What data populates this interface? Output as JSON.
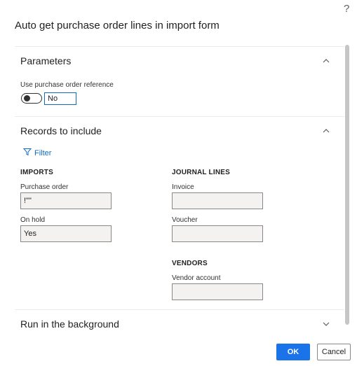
{
  "dialog": {
    "title": "Auto get purchase order lines in import form",
    "help_icon": "?"
  },
  "parameters": {
    "header": "Parameters",
    "use_po_reference_label": "Use purchase order reference",
    "use_po_reference_value": "No",
    "toggle_on": false
  },
  "records": {
    "header": "Records to include",
    "filter_label": "Filter",
    "imports": {
      "group_label": "IMPORTS",
      "purchase_order_label": "Purchase order",
      "purchase_order_value": "!\"\"",
      "on_hold_label": "On hold",
      "on_hold_value": "Yes"
    },
    "journal_lines": {
      "group_label": "JOURNAL LINES",
      "invoice_label": "Invoice",
      "invoice_value": "",
      "voucher_label": "Voucher",
      "voucher_value": ""
    },
    "vendors": {
      "group_label": "VENDORS",
      "vendor_account_label": "Vendor account",
      "vendor_account_value": ""
    }
  },
  "background": {
    "header": "Run in the background"
  },
  "buttons": {
    "ok_label": "OK",
    "cancel_label": "Cancel"
  },
  "colors": {
    "accent": "#1a73e8",
    "link": "#0f6cbd",
    "field_bg": "#f3f2f1"
  },
  "icons": {
    "help": "help-icon",
    "collapse": "chevron-up-icon",
    "expand": "chevron-down-icon",
    "filter": "filter-icon"
  }
}
